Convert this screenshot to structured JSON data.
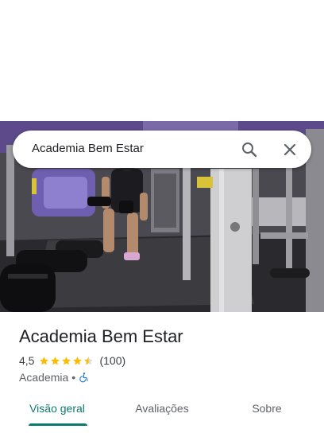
{
  "search": {
    "query": "Academia Bem Estar"
  },
  "icons": {
    "search": "search-icon",
    "close": "close-icon",
    "accessibility": "wheelchair-icon"
  },
  "place": {
    "name": "Academia Bem Estar",
    "rating": "4,5",
    "rating_fraction": 0.9,
    "reviews": "(100)",
    "category": "Academia",
    "separator": "•"
  },
  "tabs": [
    {
      "label": "Visão geral",
      "active": true
    },
    {
      "label": "Avaliações",
      "active": false
    },
    {
      "label": "Sobre",
      "active": false
    }
  ],
  "colors": {
    "accent": "#0b7a6f",
    "star": "#fbbc04",
    "access": "#1a73e8"
  }
}
